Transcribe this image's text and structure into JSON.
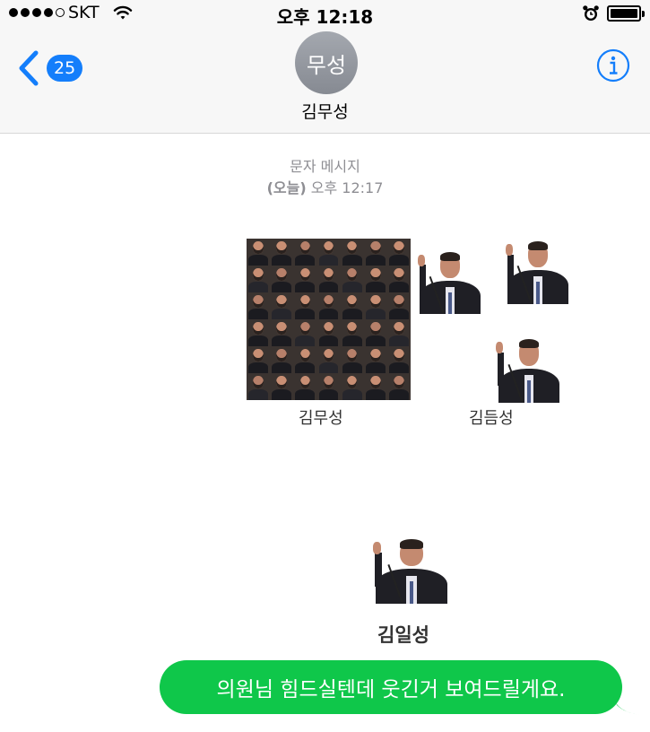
{
  "status_bar": {
    "signal_dots_filled": 4,
    "signal_dots_total": 5,
    "carrier": "SKT",
    "time": "오후 12:18",
    "battery_level": 1.0
  },
  "header": {
    "back_count": "25",
    "avatar_text": "무성",
    "contact_name": "김무성",
    "info_icon": "info-icon"
  },
  "thread": {
    "type_label": "문자 메시지",
    "day": "(오늘)",
    "timestamp": "오후 12:17"
  },
  "image_message": {
    "captions": [
      "김무성",
      "김듬성",
      "김일성"
    ]
  },
  "sent_message": {
    "text": "의원님 힘드실텐데 웃긴거 보여드릴게요.",
    "bubble_color": "#0fc74a"
  },
  "colors": {
    "accent": "#147efb",
    "timestamp_gray": "#8e8e93"
  }
}
